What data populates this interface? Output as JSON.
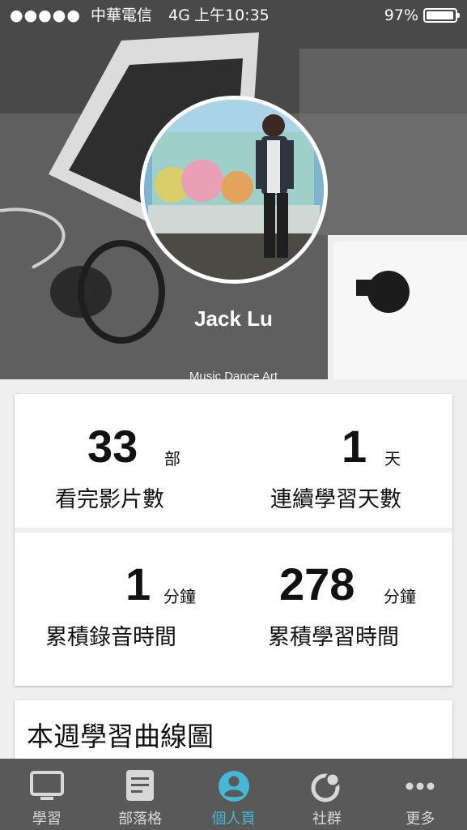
{
  "status_bar": {
    "signal_dots": "●●●●●",
    "carrier": "中華電信",
    "network": "4G",
    "time": "上午10:35",
    "battery_percent": "97%",
    "battery_level": 0.97
  },
  "profile": {
    "name": "Jack Lu",
    "tagline": "Music  Dance  Art"
  },
  "stats": [
    {
      "value": "33",
      "unit": "部",
      "label": "看完影片數"
    },
    {
      "value": "1",
      "unit": "天",
      "label": "連續學習天數"
    },
    {
      "value": "1",
      "unit": "分鐘",
      "label": "累積錄音時間"
    },
    {
      "value": "278",
      "unit": "分鐘",
      "label": "累積學習時間"
    }
  ],
  "chart_card": {
    "title": "本週學習曲線圖"
  },
  "tab_bar": {
    "active_color": "#45b8d8",
    "items": [
      {
        "label": "學習",
        "icon": "tv-icon"
      },
      {
        "label": "部落格",
        "icon": "document-icon"
      },
      {
        "label": "個人頁",
        "icon": "person-icon",
        "active": true
      },
      {
        "label": "社群",
        "icon": "community-icon"
      },
      {
        "label": "更多",
        "icon": "more-icon"
      }
    ]
  }
}
